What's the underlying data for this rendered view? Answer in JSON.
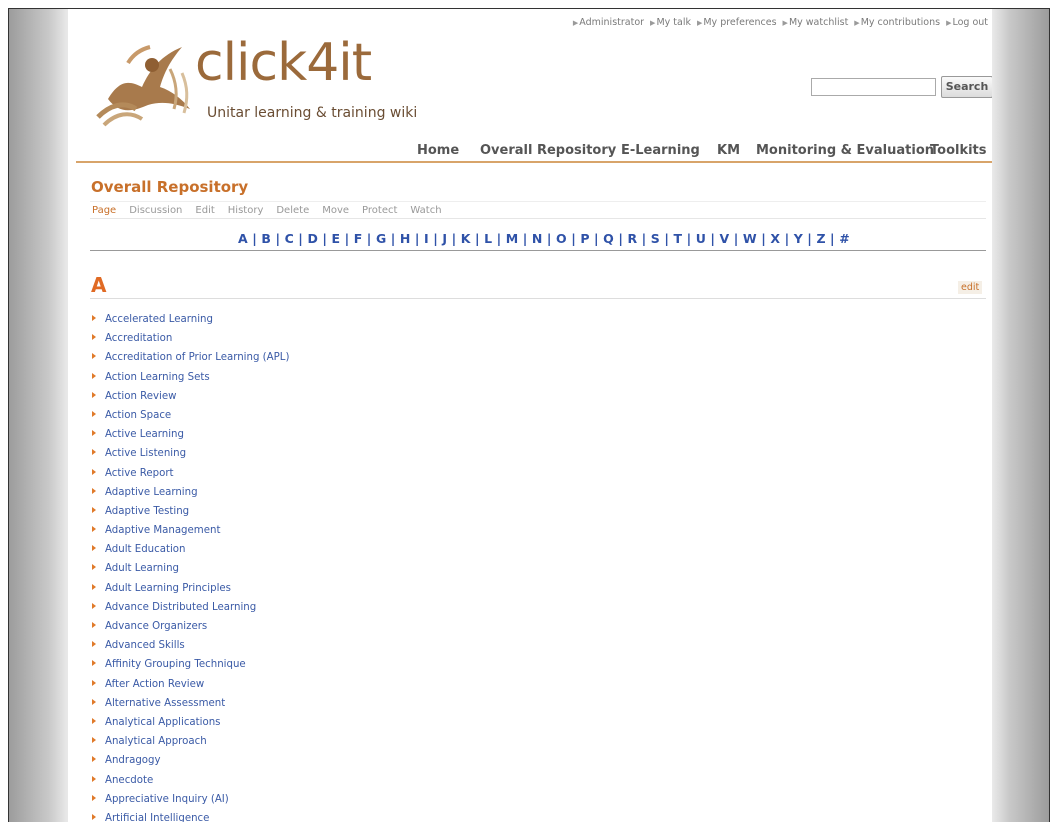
{
  "personal_links": [
    "Administrator",
    "My talk",
    "My preferences",
    "My watchlist",
    "My contributions",
    "Log out"
  ],
  "logo": {
    "title": "click4it",
    "subtitle": "Unitar learning & training wiki"
  },
  "search": {
    "button_label": "Search",
    "value": ""
  },
  "main_nav": [
    "Home",
    "Overall Repository",
    "E-Learning",
    "KM",
    "Monitoring & Evaluation",
    "Toolkits"
  ],
  "page": {
    "title": "Overall Repository",
    "actions": [
      "Page",
      "Discussion",
      "Edit",
      "History",
      "Delete",
      "Move",
      "Protect",
      "Watch"
    ],
    "selected_action": "Page"
  },
  "alphabet": [
    "A",
    "B",
    "C",
    "D",
    "E",
    "F",
    "G",
    "H",
    "I",
    "J",
    "K",
    "L",
    "M",
    "N",
    "O",
    "P",
    "Q",
    "R",
    "S",
    "T",
    "U",
    "V",
    "W",
    "X",
    "Y",
    "Z",
    "#"
  ],
  "section": {
    "heading": "A",
    "edit_label": "edit",
    "items": [
      "Accelerated Learning",
      "Accreditation",
      "Accreditation of Prior Learning (APL)",
      "Action Learning Sets",
      "Action Review",
      "Action Space",
      "Active Learning",
      "Active Listening",
      "Active Report",
      "Adaptive Learning",
      "Adaptive Testing",
      "Adaptive Management",
      "Adult Education",
      "Adult Learning",
      "Adult Learning Principles",
      "Advance Distributed Learning",
      "Advance Organizers",
      "Advanced Skills",
      "Affinity Grouping Technique",
      "After Action Review",
      "Alternative Assessment",
      "Analytical Applications",
      "Analytical Approach",
      "Andragogy",
      "Anecdote",
      "Appreciative Inquiry (AI)",
      "Artificial Intelligence"
    ]
  },
  "colors": {
    "accent": "#c8702a",
    "link": "#2f52a8",
    "logo": "#9b6a3b"
  }
}
